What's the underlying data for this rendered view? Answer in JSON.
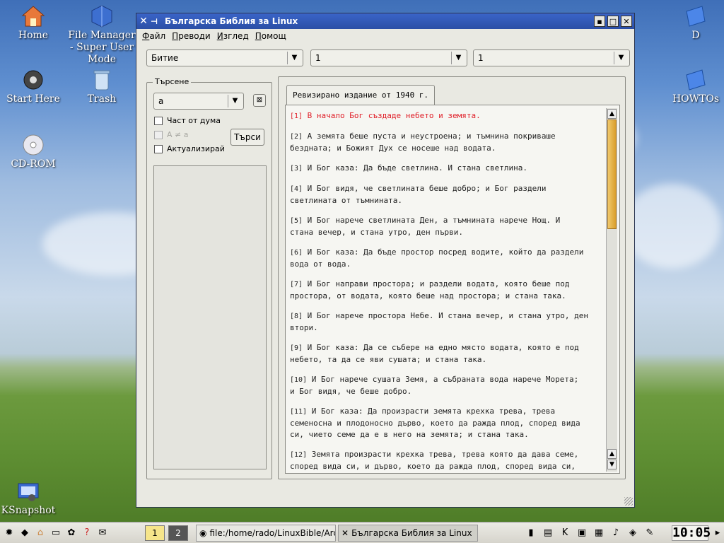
{
  "desktop": {
    "icons": [
      {
        "label": "Home"
      },
      {
        "label": "File Manager - Super User Mode"
      },
      {
        "label": "Start Here"
      },
      {
        "label": "Trash"
      },
      {
        "label": "CD-ROM"
      },
      {
        "label": "KSnapshot"
      },
      {
        "label": "D"
      },
      {
        "label": "HOWTOs"
      }
    ]
  },
  "window": {
    "title": "Българска Библия за Linux",
    "menu": [
      "Файл",
      "Преводи",
      "Изглед",
      "Помощ"
    ],
    "book_select": "Битие",
    "chapter_select": "1",
    "verse_select": "1",
    "search": {
      "legend": "Търсене",
      "query": "а",
      "part_of_word": "Част от дума",
      "case_sensitive": "A ≠ a",
      "refresh": "Актуализирай",
      "search_button": "Търси"
    },
    "tab_label": "Ревизирано издание от 1940 г.",
    "verses": [
      {
        "num": "[1]",
        "text": " В начало Бог създаде небето и земята."
      },
      {
        "num": "[2]",
        "text": " А земята беше пуста и неустроена; и тъмнина покриваше\nбездната; и Божият Дух се носеше над водата."
      },
      {
        "num": "[3]",
        "text": " И Бог каза: Да бъде светлина. И стана светлина."
      },
      {
        "num": "[4]",
        "text": " И Бог видя, че светлината беше добро; и Бог раздели\nсветлината от тъмнината."
      },
      {
        "num": "[5]",
        "text": " И Бог нарече светлината Ден, а тъмнината нарече Нощ. И\nстана вечер, и стана утро, ден първи."
      },
      {
        "num": "[6]",
        "text": " И Бог каза: Да бъде простор посред водите, който да раздели\nвода от вода."
      },
      {
        "num": "[7]",
        "text": " И Бог направи простора; и раздели водата, която беше под\nпростора, от водата, която беше над простора; и стана така."
      },
      {
        "num": "[8]",
        "text": " И Бог нарече простора Небе. И стана вечер, и стана утро, ден\nвтори."
      },
      {
        "num": "[9]",
        "text": " И Бог каза: Да се събере на едно място водата, която е под\nнебето, та да се яви сушата; и стана така."
      },
      {
        "num": "[10]",
        "text": " И Бог нарече сушата Земя, а събраната вода нарече Морета;\nи Бог видя, че беше добро."
      },
      {
        "num": "[11]",
        "text": " И Бог каза: Да произрасти земята крехка трева, трева\nсеменосна и плодоносно дърво, което да ражда плод, според вида\nси, чието семе да е в него на земята; и стана така."
      },
      {
        "num": "[12]",
        "text": " Земята произрасти крехка трева, трева която да дава семе,\nспоред вида си, и дърво, което да ражда плод, според вида си,\nчието семе е в него; и Бог видя, че беше добро."
      }
    ]
  },
  "taskbar": {
    "pager": [
      "1",
      "2"
    ],
    "tasks": [
      "file:/home/rado/LinuxBible/Arc",
      "Българска Библия за Linux"
    ],
    "clock": "10:05"
  },
  "colors": {
    "title_bar": "#2b4fa6",
    "highlight_verse": "#e0202a"
  }
}
